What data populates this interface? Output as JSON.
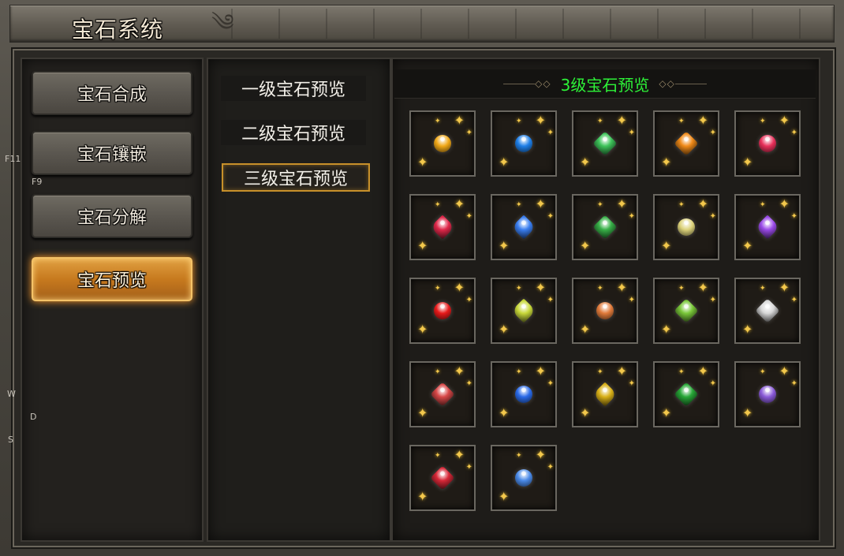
{
  "window": {
    "title": "宝石系统"
  },
  "side_menu": [
    {
      "label": "宝石合成",
      "active": false
    },
    {
      "label": "宝石镶嵌",
      "active": false
    },
    {
      "label": "宝石分解",
      "active": false
    },
    {
      "label": "宝石预览",
      "active": true
    }
  ],
  "edge_labels": {
    "f11": "F11",
    "f9": "F9",
    "w": "W",
    "d": "D",
    "s": "S"
  },
  "level_tabs": [
    {
      "label": "一级宝石预览",
      "active": false
    },
    {
      "label": "二级宝石预览",
      "active": false
    },
    {
      "label": "三级宝石预览",
      "active": true
    }
  ],
  "preview": {
    "title": "3级宝石预览",
    "title_color": "#2df238",
    "gems": [
      {
        "icon": "yellow-gem-icon",
        "color": "#f0a818",
        "shape": "round"
      },
      {
        "icon": "blue-gem-icon",
        "color": "#1e7fe8",
        "shape": "round"
      },
      {
        "icon": "green-gem-icon",
        "color": "#3ec45a",
        "shape": "square"
      },
      {
        "icon": "orange-gem-icon",
        "color": "#f08a18",
        "shape": "square"
      },
      {
        "icon": "red-gem-icon",
        "color": "#e8305a",
        "shape": "round"
      },
      {
        "icon": "crimson-gem-icon",
        "color": "#e0284a",
        "shape": "tri"
      },
      {
        "icon": "blue-crystal-icon",
        "color": "#3a7ef0",
        "shape": "tri"
      },
      {
        "icon": "green-gem-icon",
        "color": "#38b048",
        "shape": "square"
      },
      {
        "icon": "pale-yellow-gem-icon",
        "color": "#dcd27a",
        "shape": "round"
      },
      {
        "icon": "purple-gem-icon",
        "color": "#9a4ae8",
        "shape": "tri"
      },
      {
        "icon": "ruby-gem-icon",
        "color": "#e81a1a",
        "shape": "round"
      },
      {
        "icon": "lime-gem-icon",
        "color": "#c8d83a",
        "shape": "tri"
      },
      {
        "icon": "orange-cluster-gem-icon",
        "color": "#e07a3a",
        "shape": "round"
      },
      {
        "icon": "green-cluster-gem-icon",
        "color": "#7ac83a",
        "shape": "square"
      },
      {
        "icon": "white-diamond-icon",
        "color": "#d8d8d8",
        "shape": "square"
      },
      {
        "icon": "red-faceted-gem-icon",
        "color": "#d84848",
        "shape": "square"
      },
      {
        "icon": "sapphire-gem-icon",
        "color": "#2a6ae8",
        "shape": "round"
      },
      {
        "icon": "gold-gem-icon",
        "color": "#d8b018",
        "shape": "tri"
      },
      {
        "icon": "emerald-gem-icon",
        "color": "#28a838",
        "shape": "square"
      },
      {
        "icon": "amethyst-gem-icon",
        "color": "#8a5ad8",
        "shape": "round"
      },
      {
        "icon": "red-crystal-icon",
        "color": "#d82838",
        "shape": "square"
      },
      {
        "icon": "light-blue-gem-icon",
        "color": "#4a8ae8",
        "shape": "round"
      }
    ]
  }
}
